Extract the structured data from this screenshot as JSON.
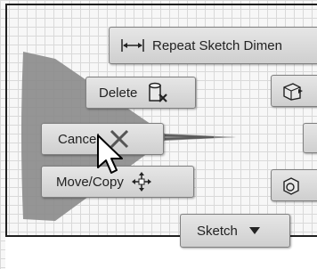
{
  "toolbar": {
    "repeat_sketch_dimension_label": "Repeat Sketch Dimen",
    "repeat_icon": "dimension-icon"
  },
  "marking_menu": {
    "delete_label": "Delete",
    "delete_icon": "delete-icon",
    "cancel_label": "Cancel",
    "cancel_icon": "cancel-x-icon",
    "move_copy_label": "Move/Copy",
    "move_copy_icon": "move-arrows-icon",
    "sketch_label": "Sketch",
    "sketch_dropdown_icon": "triangle-down-icon"
  },
  "colors": {
    "pie_shade": "#8c8c8c",
    "button_face": "#dcdcdc",
    "grid_line": "#d9d9d9"
  }
}
